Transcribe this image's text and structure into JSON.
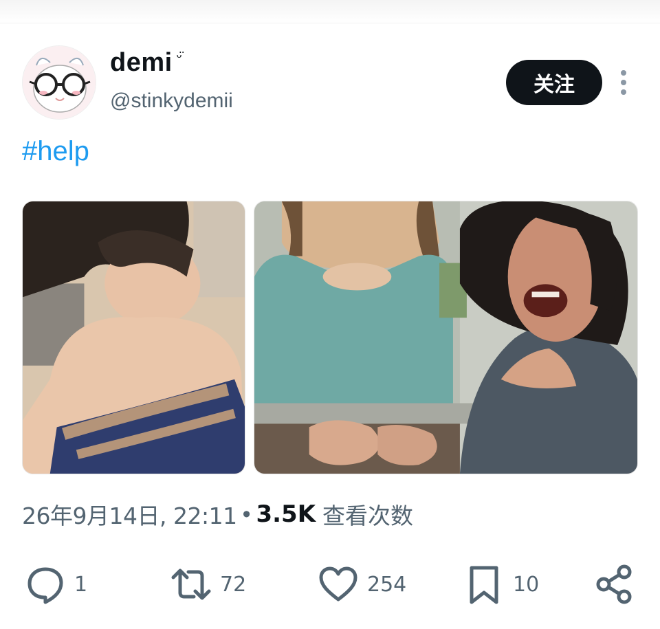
{
  "post": {
    "author": {
      "display_name": "demi",
      "name_emoji": "ᵕ̈",
      "handle": "@stinkydemii",
      "avatar_icon": "cartoon-sheep-with-glasses"
    },
    "follow_label": "关注",
    "more_icon": "vertical-ellipsis-icon",
    "hashtag": "#help",
    "media": [
      {
        "description_icon": "photo-person-with-towel"
      },
      {
        "description_icon": "photo-laughing-woman-meme"
      }
    ],
    "timestamp": "26年9月14日, 22:11",
    "separator": "•",
    "views_count": "3.5K",
    "views_label": "查看次数",
    "actions": {
      "reply": {
        "icon": "reply-bubble-icon",
        "count": "1"
      },
      "repost": {
        "icon": "repost-icon",
        "count": "72"
      },
      "like": {
        "icon": "heart-icon",
        "count": "254"
      },
      "bookmark": {
        "icon": "bookmark-icon",
        "count": "10"
      },
      "share": {
        "icon": "share-icon"
      }
    }
  },
  "colors": {
    "link": "#1d9bf0",
    "secondary_text": "#536471",
    "primary_text": "#0f1419",
    "button_bg": "#0f1419"
  }
}
